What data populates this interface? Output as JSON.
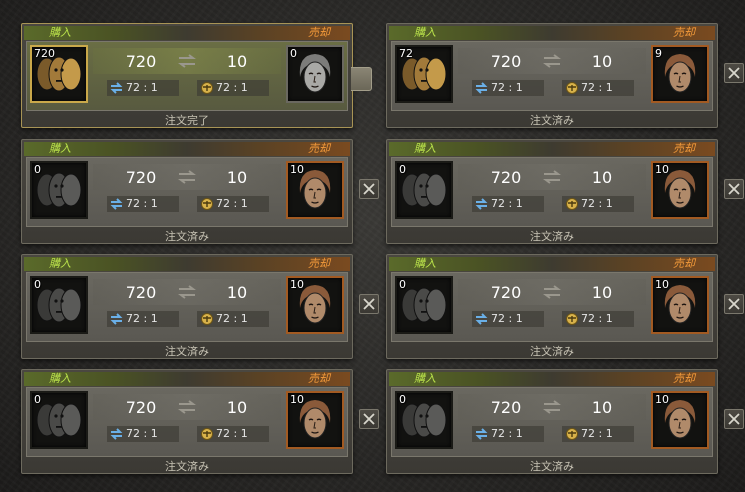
{
  "labels": {
    "buy": "購入",
    "sell": "売却"
  },
  "orders": [
    {
      "buy_count": "720",
      "sell_count": "0",
      "pay": "720",
      "receive": "10",
      "rate_a": "72 : 1",
      "rate_b": "72 : 1",
      "status": "注文完了",
      "state": "done"
    },
    {
      "buy_count": "72",
      "sell_count": "9",
      "pay": "720",
      "receive": "10",
      "rate_a": "72 : 1",
      "rate_b": "72 : 1",
      "status": "注文済み",
      "state": "partial"
    },
    {
      "buy_count": "0",
      "sell_count": "10",
      "pay": "720",
      "receive": "10",
      "rate_a": "72 : 1",
      "rate_b": "72 : 1",
      "status": "注文済み",
      "state": "open"
    },
    {
      "buy_count": "0",
      "sell_count": "10",
      "pay": "720",
      "receive": "10",
      "rate_a": "72 : 1",
      "rate_b": "72 : 1",
      "status": "注文済み",
      "state": "open"
    },
    {
      "buy_count": "0",
      "sell_count": "10",
      "pay": "720",
      "receive": "10",
      "rate_a": "72 : 1",
      "rate_b": "72 : 1",
      "status": "注文済み",
      "state": "open"
    },
    {
      "buy_count": "0",
      "sell_count": "10",
      "pay": "720",
      "receive": "10",
      "rate_a": "72 : 1",
      "rate_b": "72 : 1",
      "status": "注文済み",
      "state": "open"
    },
    {
      "buy_count": "0",
      "sell_count": "10",
      "pay": "720",
      "receive": "10",
      "rate_a": "72 : 1",
      "rate_b": "72 : 1",
      "status": "注文済み",
      "state": "open"
    },
    {
      "buy_count": "0",
      "sell_count": "10",
      "pay": "720",
      "receive": "10",
      "rate_a": "72 : 1",
      "rate_b": "72 : 1",
      "status": "注文済み",
      "state": "open"
    }
  ],
  "icons": {
    "buy_item": "triple-mask-icon",
    "sell_item": "face-relief-icon",
    "swap": "swap-arrows-icon",
    "rate_a": "exchange-icon",
    "rate_b": "scale-icon",
    "close": "close-icon"
  },
  "colors": {
    "buy": "#b8e04a",
    "sell": "#f39a3a",
    "done_border": "#c9a84a"
  }
}
